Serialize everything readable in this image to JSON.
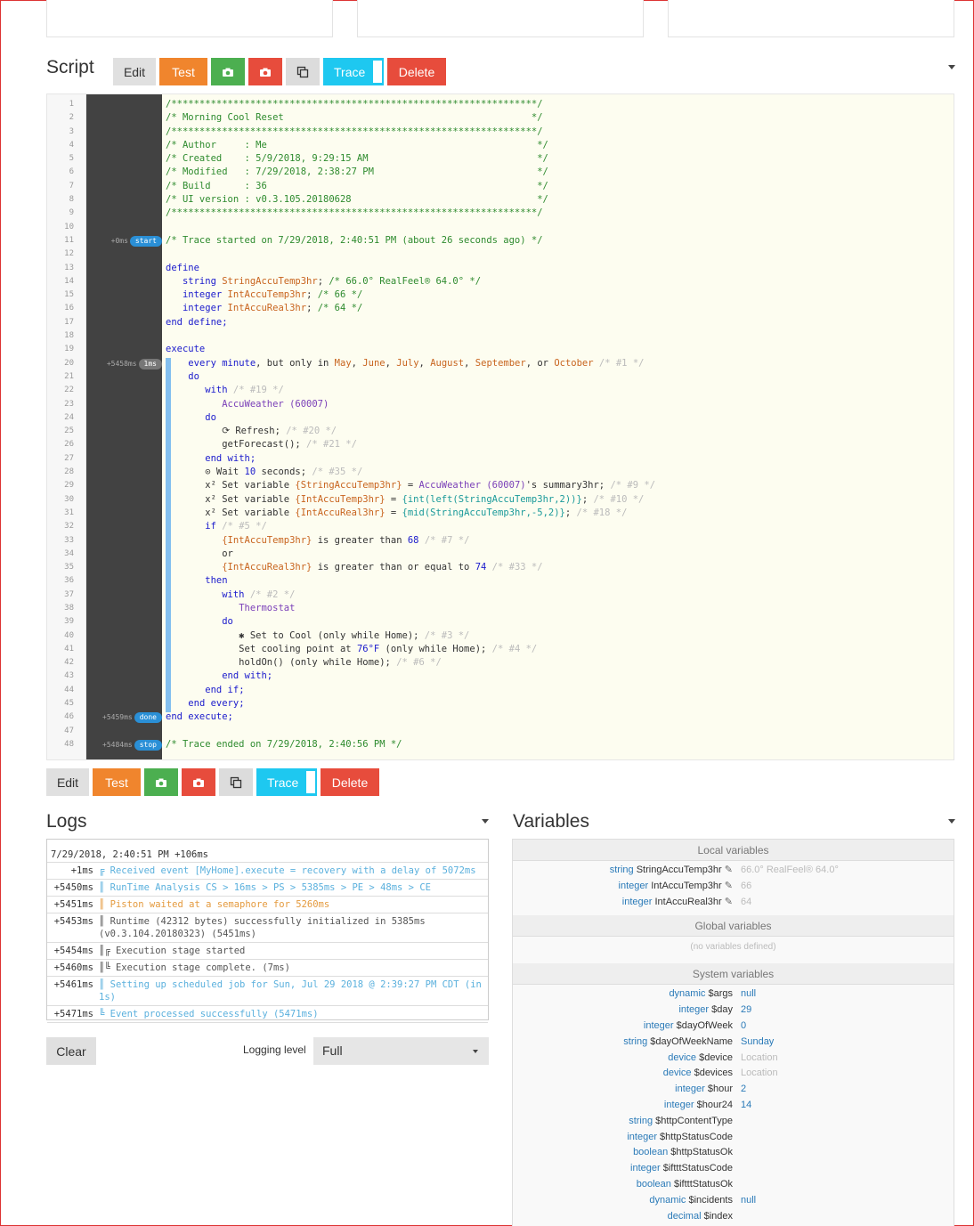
{
  "script": {
    "title": "Script",
    "buttons": {
      "edit": "Edit",
      "test": "Test",
      "trace": "Trace",
      "delete": "Delete"
    },
    "lines": [
      {
        "n": "1",
        "t": [
          [
            "c",
            "/*****************************************************************/"
          ]
        ]
      },
      {
        "n": "2",
        "t": [
          [
            "c",
            "/* Morning Cool Reset                                            */"
          ]
        ]
      },
      {
        "n": "3",
        "t": [
          [
            "c",
            "/*****************************************************************/"
          ]
        ]
      },
      {
        "n": "4",
        "t": [
          [
            "c",
            "/* Author     : Me                                                */"
          ]
        ]
      },
      {
        "n": "5",
        "t": [
          [
            "c",
            "/* Created    : 5/9/2018, 9:29:15 AM                              */"
          ]
        ]
      },
      {
        "n": "6",
        "t": [
          [
            "c",
            "/* Modified   : 7/29/2018, 2:38:27 PM                             */"
          ]
        ]
      },
      {
        "n": "7",
        "t": [
          [
            "c",
            "/* Build      : 36                                                */"
          ]
        ]
      },
      {
        "n": "8",
        "t": [
          [
            "c",
            "/* UI version : v0.3.105.20180628                                 */"
          ]
        ]
      },
      {
        "n": "9",
        "t": [
          [
            "c",
            "/*****************************************************************/"
          ]
        ]
      },
      {
        "n": "10",
        "t": []
      },
      {
        "n": "11",
        "mark": "+0ms",
        "pill": "start",
        "t": [
          [
            "c",
            "/* Trace started on 7/29/2018, 2:40:51 PM (about 26 seconds ago) */"
          ]
        ]
      },
      {
        "n": "12",
        "t": []
      },
      {
        "n": "13",
        "t": [
          [
            "k",
            "define"
          ]
        ]
      },
      {
        "n": "14",
        "t": [
          [
            "o",
            "   "
          ],
          [
            "k",
            "string "
          ],
          [
            "v",
            "StringAccuTemp3hr"
          ],
          [
            "o",
            "; "
          ],
          [
            "c",
            "/* 66.0° RealFeel® 64.0° */"
          ]
        ]
      },
      {
        "n": "15",
        "t": [
          [
            "o",
            "   "
          ],
          [
            "k",
            "integer "
          ],
          [
            "v",
            "IntAccuTemp3hr"
          ],
          [
            "o",
            "; "
          ],
          [
            "c",
            "/* 66 */"
          ]
        ]
      },
      {
        "n": "16",
        "t": [
          [
            "o",
            "   "
          ],
          [
            "k",
            "integer "
          ],
          [
            "v",
            "IntAccuReal3hr"
          ],
          [
            "o",
            "; "
          ],
          [
            "c",
            "/* 64 */"
          ]
        ]
      },
      {
        "n": "17",
        "t": [
          [
            "k",
            "end define;"
          ]
        ]
      },
      {
        "n": "18",
        "t": []
      },
      {
        "n": "19",
        "t": [
          [
            "k",
            "execute"
          ]
        ]
      },
      {
        "n": "20",
        "mark": "+5458ms",
        "pill": "1ms",
        "gray": true,
        "t": [
          [
            "o",
            "    "
          ],
          [
            "k",
            "every minute"
          ],
          [
            "o",
            ", but only in "
          ],
          [
            "v",
            "May"
          ],
          [
            "o",
            ", "
          ],
          [
            "v",
            "June"
          ],
          [
            "o",
            ", "
          ],
          [
            "v",
            "July"
          ],
          [
            "o",
            ", "
          ],
          [
            "v",
            "August"
          ],
          [
            "o",
            ", "
          ],
          [
            "v",
            "September"
          ],
          [
            "o",
            ", or "
          ],
          [
            "v",
            "October"
          ],
          [
            "g",
            " /* #1 */"
          ]
        ]
      },
      {
        "n": "21",
        "t": [
          [
            "o",
            "    "
          ],
          [
            "k",
            "do"
          ]
        ]
      },
      {
        "n": "22",
        "t": [
          [
            "o",
            "       "
          ],
          [
            "k",
            "with"
          ],
          [
            "g",
            " /* #19 */"
          ]
        ]
      },
      {
        "n": "23",
        "t": [
          [
            "o",
            "          "
          ],
          [
            "d",
            "AccuWeather (60007)"
          ]
        ]
      },
      {
        "n": "24",
        "t": [
          [
            "o",
            "       "
          ],
          [
            "k",
            "do"
          ]
        ]
      },
      {
        "n": "25",
        "t": [
          [
            "o",
            "          ⟳ Refresh; "
          ],
          [
            "g",
            "/* #20 */"
          ]
        ]
      },
      {
        "n": "26",
        "t": [
          [
            "o",
            "          getForecast(); "
          ],
          [
            "g",
            "/* #21 */"
          ]
        ]
      },
      {
        "n": "27",
        "t": [
          [
            "o",
            "       "
          ],
          [
            "k",
            "end with;"
          ]
        ]
      },
      {
        "n": "28",
        "t": [
          [
            "o",
            "       ⊙ Wait "
          ],
          [
            "n",
            "10"
          ],
          [
            "o",
            " seconds; "
          ],
          [
            "g",
            "/* #35 */"
          ]
        ]
      },
      {
        "n": "29",
        "t": [
          [
            "o",
            "       x² Set variable "
          ],
          [
            "v",
            "{StringAccuTemp3hr}"
          ],
          [
            "o",
            " = "
          ],
          [
            "d",
            "AccuWeather (60007)"
          ],
          [
            "o",
            "'s "
          ],
          [
            "o",
            "summary3hr"
          ],
          [
            "o",
            "; "
          ],
          [
            "g",
            "/* #9 */"
          ]
        ]
      },
      {
        "n": "30",
        "t": [
          [
            "o",
            "       x² Set variable "
          ],
          [
            "v",
            "{IntAccuTemp3hr}"
          ],
          [
            "o",
            " = "
          ],
          [
            "f",
            "{int(left(StringAccuTemp3hr,2))}"
          ],
          [
            "o",
            "; "
          ],
          [
            "g",
            "/* #10 */"
          ]
        ]
      },
      {
        "n": "31",
        "t": [
          [
            "o",
            "       x² Set variable "
          ],
          [
            "v",
            "{IntAccuReal3hr}"
          ],
          [
            "o",
            " = "
          ],
          [
            "f",
            "{mid(StringAccuTemp3hr,-5,2)}"
          ],
          [
            "o",
            "; "
          ],
          [
            "g",
            "/* #18 */"
          ]
        ]
      },
      {
        "n": "32",
        "t": [
          [
            "o",
            "       "
          ],
          [
            "k",
            "if"
          ],
          [
            "g",
            " /* #5 */"
          ]
        ]
      },
      {
        "n": "33",
        "t": [
          [
            "o",
            "          "
          ],
          [
            "v",
            "{IntAccuTemp3hr}"
          ],
          [
            "o",
            " is greater than "
          ],
          [
            "n",
            "68"
          ],
          [
            "g",
            " /* #7 */"
          ]
        ]
      },
      {
        "n": "34",
        "t": [
          [
            "o",
            "          or"
          ]
        ]
      },
      {
        "n": "35",
        "t": [
          [
            "o",
            "          "
          ],
          [
            "v",
            "{IntAccuReal3hr}"
          ],
          [
            "o",
            " is greater than or equal to "
          ],
          [
            "n",
            "74"
          ],
          [
            "g",
            " /* #33 */"
          ]
        ]
      },
      {
        "n": "36",
        "t": [
          [
            "o",
            "       "
          ],
          [
            "k",
            "then"
          ]
        ]
      },
      {
        "n": "37",
        "t": [
          [
            "o",
            "          "
          ],
          [
            "k",
            "with"
          ],
          [
            "g",
            " /* #2 */"
          ]
        ]
      },
      {
        "n": "38",
        "t": [
          [
            "o",
            "             "
          ],
          [
            "d",
            "Thermostat"
          ]
        ]
      },
      {
        "n": "39",
        "t": [
          [
            "o",
            "          "
          ],
          [
            "k",
            "do"
          ]
        ]
      },
      {
        "n": "40",
        "t": [
          [
            "o",
            "             ✱ Set to Cool (only while Home); "
          ],
          [
            "g",
            "/* #3 */"
          ]
        ]
      },
      {
        "n": "41",
        "t": [
          [
            "o",
            "             Set cooling point at "
          ],
          [
            "n",
            "76°F"
          ],
          [
            "o",
            " (only while Home); "
          ],
          [
            "g",
            "/* #4 */"
          ]
        ]
      },
      {
        "n": "42",
        "t": [
          [
            "o",
            "             holdOn() (only while Home); "
          ],
          [
            "g",
            "/* #6 */"
          ]
        ]
      },
      {
        "n": "43",
        "t": [
          [
            "o",
            "          "
          ],
          [
            "k",
            "end with;"
          ]
        ]
      },
      {
        "n": "44",
        "t": [
          [
            "o",
            "       "
          ],
          [
            "k",
            "end if;"
          ]
        ]
      },
      {
        "n": "45",
        "t": [
          [
            "o",
            "    "
          ],
          [
            "k",
            "end every;"
          ]
        ]
      },
      {
        "n": "46",
        "mark": "+5459ms",
        "pill": "done",
        "t": [
          [
            "k",
            "end execute;"
          ]
        ]
      },
      {
        "n": "47",
        "t": []
      },
      {
        "n": "48",
        "mark": "+5484ms",
        "pill": "stop",
        "t": [
          [
            "c",
            "/* Trace ended on 7/29/2018, 2:40:56 PM */"
          ]
        ]
      }
    ]
  },
  "logs": {
    "title": "Logs",
    "header": "7/29/2018, 2:40:51 PM +106ms",
    "rows": [
      {
        "t": "+1ms",
        "c": "lb",
        "m": "╔ Received event [MyHome].execute = recovery with a delay of 5072ms"
      },
      {
        "t": "+5450ms",
        "c": "lb",
        "m": "║ RunTime Analysis CS > 16ms > PS > 5385ms > PE > 48ms > CE"
      },
      {
        "t": "+5451ms",
        "c": "lo",
        "m": "║ Piston waited at a semaphore for 5260ms"
      },
      {
        "t": "+5453ms",
        "c": "lg",
        "m": "║ Runtime (42312 bytes) successfully initialized in 5385ms (v0.3.104.20180323) (5451ms)"
      },
      {
        "t": "+5454ms",
        "c": "lg",
        "m": "║╔ Execution stage started"
      },
      {
        "t": "+5460ms",
        "c": "lg",
        "m": "║╚ Execution stage complete. (7ms)"
      },
      {
        "t": "+5461ms",
        "c": "lb",
        "m": "║ Setting up scheduled job for Sun, Jul 29 2018 @ 2:39:27 PM CDT (in 1s)"
      },
      {
        "t": "+5471ms",
        "c": "lb",
        "m": "╚ Event processed successfully (5471ms)"
      }
    ],
    "clear": "Clear",
    "level_label": "Logging level",
    "level_value": "Full"
  },
  "variables": {
    "title": "Variables",
    "local_header": "Local variables",
    "local": [
      {
        "type": "string",
        "name": "StringAccuTemp3hr",
        "value": "66.0° RealFeel® 64.0°"
      },
      {
        "type": "integer",
        "name": "IntAccuTemp3hr",
        "value": "66"
      },
      {
        "type": "integer",
        "name": "IntAccuReal3hr",
        "value": "64"
      }
    ],
    "global_header": "Global variables",
    "global_empty": "(no variables defined)",
    "system_header": "System variables",
    "system": [
      {
        "type": "dynamic",
        "name": "$args",
        "value": "null",
        "gray": false
      },
      {
        "type": "integer",
        "name": "$day",
        "value": "29",
        "gray": false
      },
      {
        "type": "integer",
        "name": "$dayOfWeek",
        "value": "0",
        "gray": false
      },
      {
        "type": "string",
        "name": "$dayOfWeekName",
        "value": "Sunday",
        "gray": false
      },
      {
        "type": "device",
        "name": "$device",
        "value": "Location",
        "gray": true
      },
      {
        "type": "device",
        "name": "$devices",
        "value": "Location",
        "gray": true
      },
      {
        "type": "integer",
        "name": "$hour",
        "value": "2",
        "gray": false
      },
      {
        "type": "integer",
        "name": "$hour24",
        "value": "14",
        "gray": false
      },
      {
        "type": "string",
        "name": "$httpContentType",
        "value": "",
        "gray": false
      },
      {
        "type": "integer",
        "name": "$httpStatusCode",
        "value": "",
        "gray": false
      },
      {
        "type": "boolean",
        "name": "$httpStatusOk",
        "value": "",
        "gray": false
      },
      {
        "type": "integer",
        "name": "$iftttStatusCode",
        "value": "",
        "gray": false
      },
      {
        "type": "boolean",
        "name": "$iftttStatusOk",
        "value": "",
        "gray": false
      },
      {
        "type": "dynamic",
        "name": "$incidents",
        "value": "null",
        "gray": false
      },
      {
        "type": "decimal",
        "name": "$index",
        "value": "",
        "gray": false
      }
    ]
  }
}
